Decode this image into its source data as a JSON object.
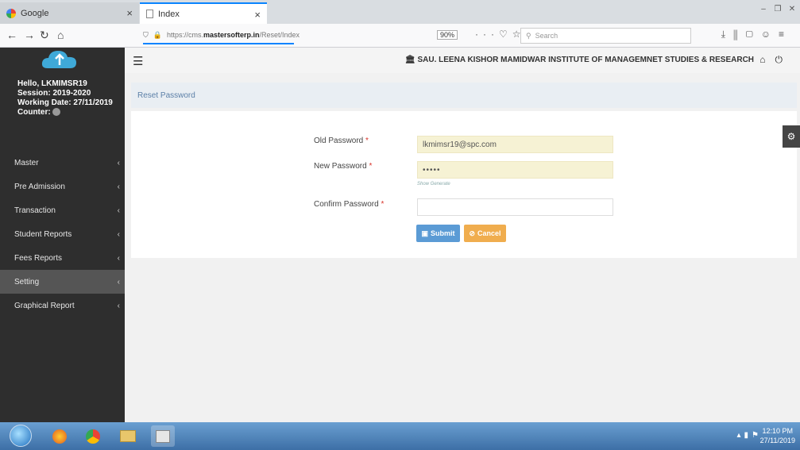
{
  "browser": {
    "tabs": [
      {
        "label": "Google"
      },
      {
        "label": "Index"
      }
    ],
    "url_prefix": "https://cms.",
    "url_domain": "mastersofterp.in",
    "url_path": "/Reset/Index",
    "zoom": "90%",
    "search_placeholder": "Search"
  },
  "sidebar": {
    "hello": "Hello, LKMIMSR19",
    "session": "Session: 2019-2020",
    "working_date": "Working Date: 27/11/2019",
    "counter_label": "Counter:",
    "menu": [
      {
        "label": "Master"
      },
      {
        "label": "Pre Admission"
      },
      {
        "label": "Transaction"
      },
      {
        "label": "Student Reports"
      },
      {
        "label": "Fees Reports"
      },
      {
        "label": "Setting"
      },
      {
        "label": "Graphical Report"
      }
    ]
  },
  "header": {
    "institute": "SAU. LEENA KISHOR MAMIDWAR INSTITUTE OF MANAGEMNET STUDIES & RESEARCH"
  },
  "page": {
    "breadcrumb": "Reset Password",
    "form": {
      "old_label": "Old Password",
      "old_value": "lkmimsr19@spc.com",
      "new_label": "New Password",
      "new_value": "•••••",
      "show_generate": "Show Generate",
      "confirm_label": "Confirm Password",
      "confirm_value": "",
      "submit_label": "Submit",
      "cancel_label": "Cancel",
      "required_mark": "*"
    }
  },
  "taskbar": {
    "time": "12:10 PM",
    "date": "27/11/2019"
  },
  "colors": {
    "sidebar_bg": "#2e2e2e",
    "submit": "#5b9bd5",
    "cancel": "#f0ad4e",
    "filled_input": "#f6f2d4",
    "breadcrumb": "#5b7fa7"
  }
}
